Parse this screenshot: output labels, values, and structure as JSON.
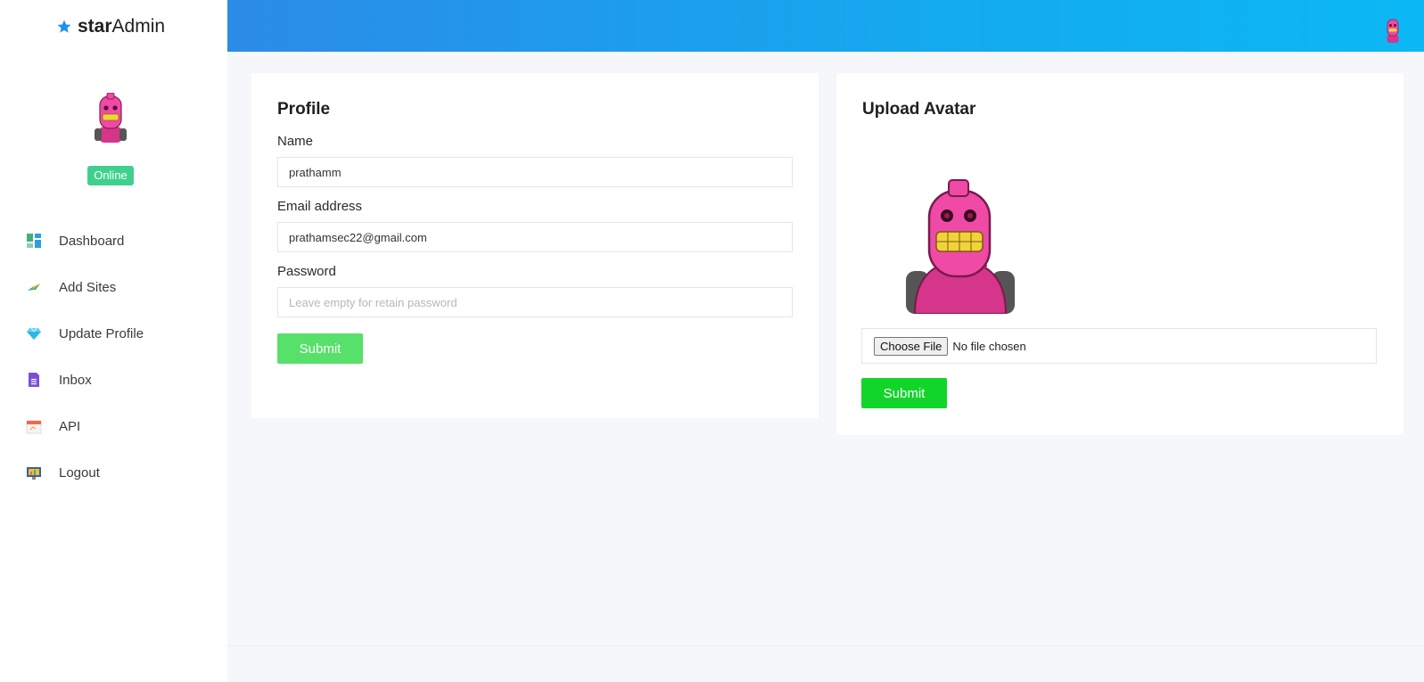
{
  "brand": {
    "part1": "star",
    "part2": "Admin"
  },
  "sidebar": {
    "status": "Online",
    "items": [
      {
        "label": "Dashboard",
        "icon": "dashboard-icon"
      },
      {
        "label": "Add Sites",
        "icon": "add-sites-icon"
      },
      {
        "label": "Update Profile",
        "icon": "diamond-icon"
      },
      {
        "label": "Inbox",
        "icon": "inbox-icon"
      },
      {
        "label": "API",
        "icon": "calendar-icon"
      },
      {
        "label": "Logout",
        "icon": "logout-icon"
      }
    ]
  },
  "profile": {
    "title": "Profile",
    "name_label": "Name",
    "name_value": "prathamm",
    "email_label": "Email address",
    "email_value": "prathamsec22@gmail.com",
    "password_label": "Password",
    "password_placeholder": "Leave empty for retain password",
    "submit_label": "Submit"
  },
  "upload": {
    "title": "Upload Avatar",
    "choose_label": "Choose File",
    "file_status": "No file chosen",
    "submit_label": "Submit"
  },
  "colors": {
    "accent": "#14aaf0",
    "online": "#3fd08e",
    "submit_light": "#57e06a",
    "submit_bright": "#12d52a",
    "avatar_pink": "#e83e9c"
  }
}
